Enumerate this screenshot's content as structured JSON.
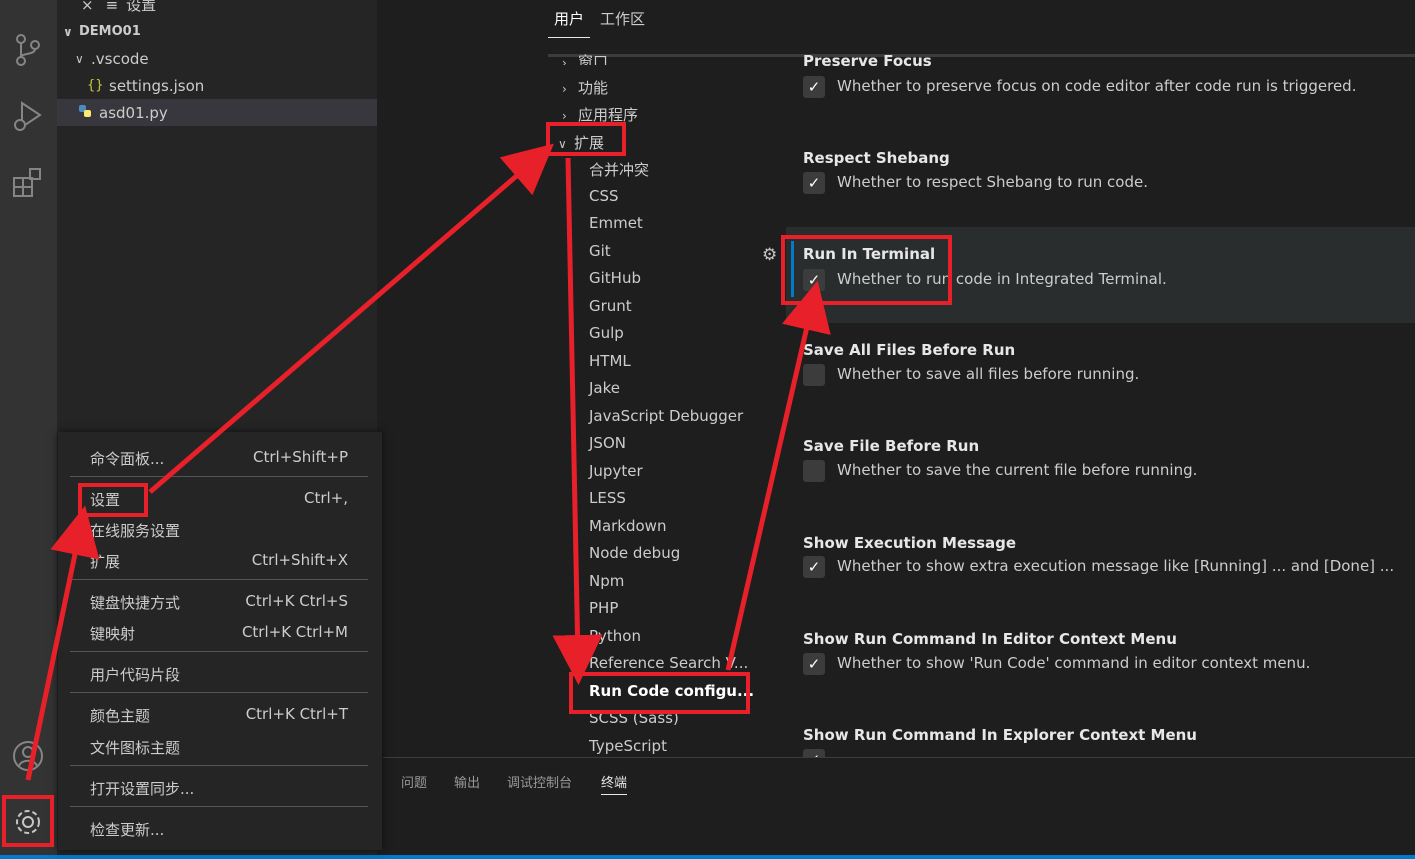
{
  "sidebar": {
    "top_tab": {
      "close": "×",
      "label": "设置"
    },
    "folder": "DEMO01",
    "items": [
      {
        "label": ".vscode",
        "icon": "chevron-down"
      },
      {
        "label": "settings.json",
        "icon": "{}"
      },
      {
        "label": "asd01.py",
        "icon": "python-icon"
      }
    ]
  },
  "settings_header": {
    "tabs": [
      "用户",
      "工作区"
    ]
  },
  "toc": {
    "items": [
      "窗口",
      "功能",
      "应用程序",
      "扩展",
      "合并冲突",
      "CSS",
      "Emmet",
      "Git",
      "GitHub",
      "Grunt",
      "Gulp",
      "HTML",
      "Jake",
      "JavaScript Debugger",
      "JSON",
      "Jupyter",
      "LESS",
      "Markdown",
      "Node debug",
      "Npm",
      "PHP",
      "Python",
      "Reference Search V...",
      "Run Code configu...",
      "SCSS (Sass)",
      "TypeScript"
    ]
  },
  "settings": [
    {
      "title": "Preserve Focus",
      "desc": "Whether to preserve focus on code editor after code run is triggered.",
      "checked": true
    },
    {
      "title": "Respect Shebang",
      "desc": "Whether to respect Shebang to run code.",
      "checked": true
    },
    {
      "title": "Run In Terminal",
      "desc": "Whether to run code in Integrated Terminal.",
      "checked": true
    },
    {
      "title": "Save All Files Before Run",
      "desc": "Whether to save all files before running.",
      "checked": false
    },
    {
      "title": "Save File Before Run",
      "desc": "Whether to save the current file before running.",
      "checked": false
    },
    {
      "title": "Show Execution Message",
      "desc": "Whether to show extra execution message like [Running] ... and [Done] ...",
      "checked": true
    },
    {
      "title": "Show Run Command In Editor Context Menu",
      "desc": "Whether to show 'Run Code' command in editor context menu.",
      "checked": true
    },
    {
      "title": "Show Run Command In Explorer Context Menu",
      "desc": "",
      "checked": true
    }
  ],
  "check_glyph": "✓",
  "panel": {
    "tabs": [
      "问题",
      "输出",
      "调试控制台",
      "终端"
    ]
  },
  "menu": {
    "items": [
      {
        "label": "命令面板...",
        "key": "Ctrl+Shift+P"
      },
      {
        "label": "设置",
        "key": "Ctrl+,"
      },
      {
        "label": "在线服务设置",
        "key": ""
      },
      {
        "label": "扩展",
        "key": "Ctrl+Shift+X"
      },
      {
        "label": "键盘快捷方式",
        "key": "Ctrl+K Ctrl+S"
      },
      {
        "label": "键映射",
        "key": "Ctrl+K Ctrl+M"
      },
      {
        "label": "用户代码片段",
        "key": ""
      },
      {
        "label": "颜色主题",
        "key": "Ctrl+K Ctrl+T"
      },
      {
        "label": "文件图标主题",
        "key": ""
      },
      {
        "label": "打开设置同步...",
        "key": ""
      },
      {
        "label": "检查更新...",
        "key": ""
      }
    ]
  },
  "colors": {
    "annotation": "#e8202a",
    "accent": "#007acc"
  }
}
